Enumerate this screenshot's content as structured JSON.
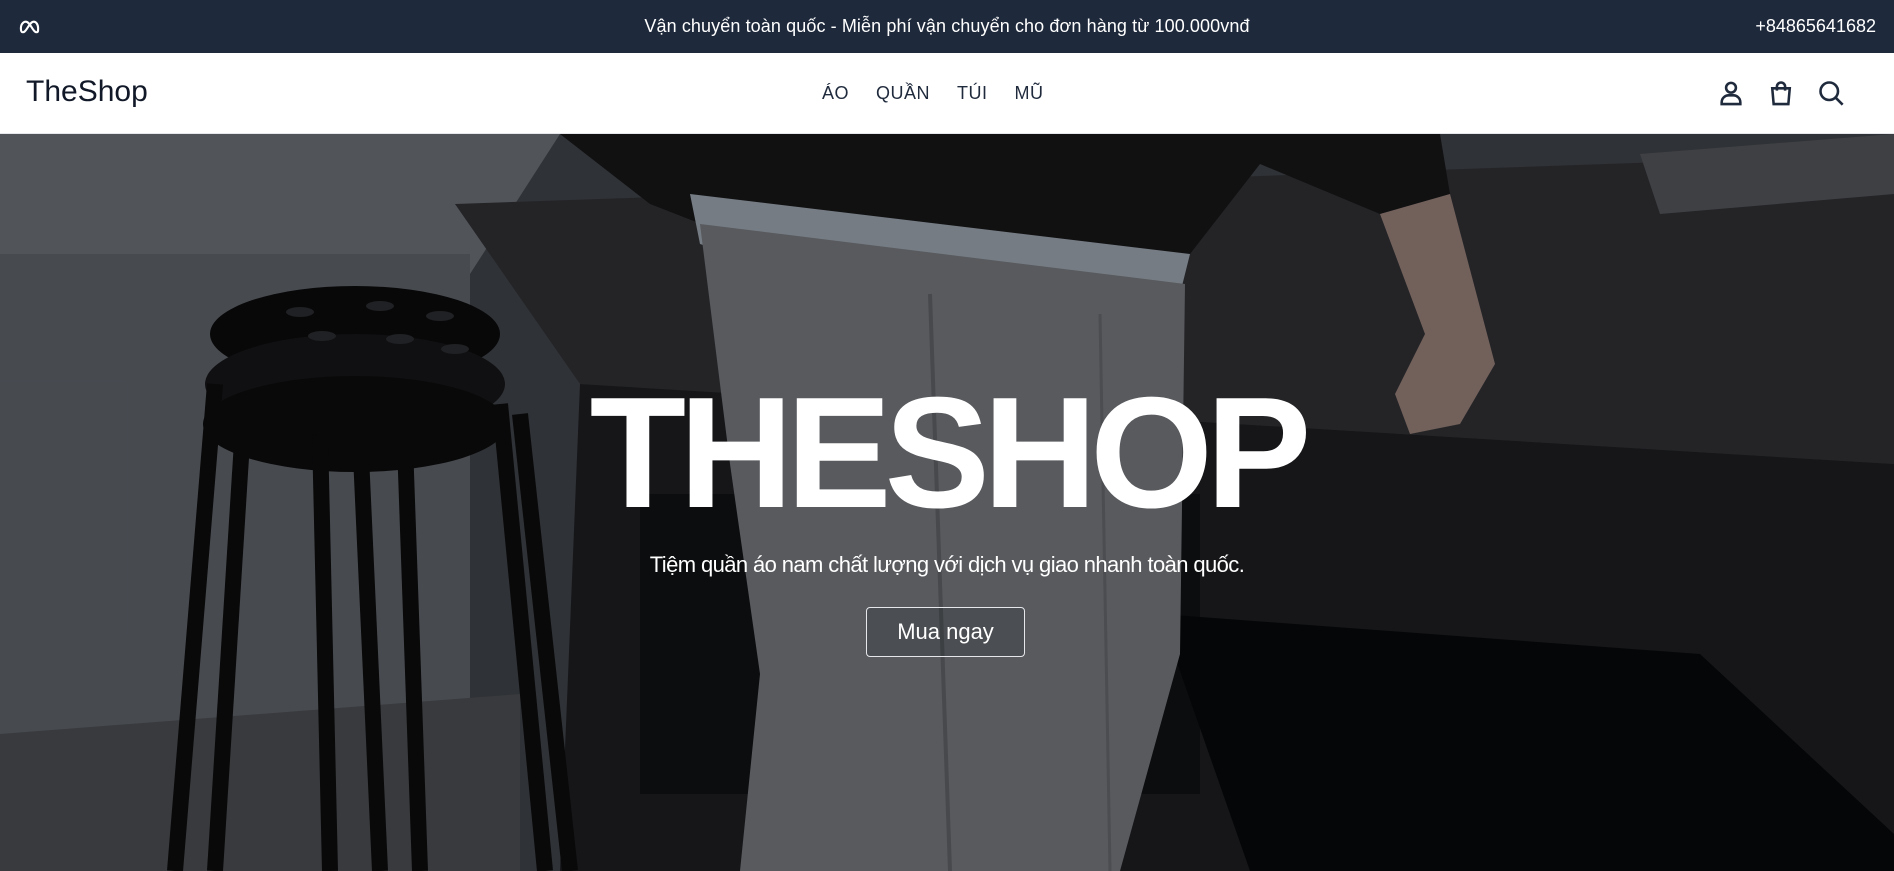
{
  "topbar": {
    "logo_icon": "meta-infinity-icon",
    "announcement": "Vận chuyển toàn quốc - Miễn phí vận chuyển cho đơn hàng từ 100.000vnđ",
    "phone": "+84865641682"
  },
  "header": {
    "brand": "TheShop",
    "nav": [
      {
        "label": "ÁO"
      },
      {
        "label": "QUẦN"
      },
      {
        "label": "TÚI"
      },
      {
        "label": "MŨ"
      }
    ],
    "icons": [
      "user-icon",
      "shopping-bag-icon",
      "search-icon"
    ]
  },
  "hero": {
    "title": "THESHOP",
    "subtitle": "Tiệm quần áo nam chất lượng với dịch vụ giao nhanh toàn quốc.",
    "cta": "Mua ngay"
  },
  "colors": {
    "topbar_bg": "#1e293b",
    "header_bg": "#ffffff",
    "nav_text": "#1f2a3c",
    "hero_text": "#ffffff"
  }
}
